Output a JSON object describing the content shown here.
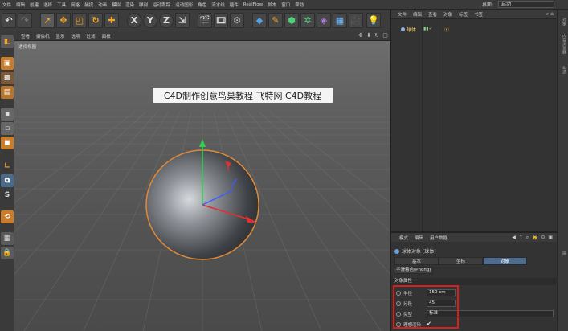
{
  "menubar": {
    "items": [
      "文件",
      "编辑",
      "创建",
      "选择",
      "工具",
      "网格",
      "捕捉",
      "动画",
      "模拟",
      "渲染",
      "雕刻",
      "运动跟踪",
      "运动图形",
      "角色",
      "流水线",
      "插件",
      "RealFlow",
      "脚本",
      "窗口",
      "帮助"
    ],
    "layout_label": "界面:",
    "layout_value": "启动"
  },
  "toolbar": {
    "icons": [
      "undo-icon",
      "redo-icon",
      "live-select-icon",
      "move-icon",
      "scale-icon",
      "rotate-icon",
      "add-icon",
      "x-axis-icon",
      "y-axis-icon",
      "z-axis-icon",
      "world-coord-icon",
      "render-view-icon",
      "render-picture-icon",
      "render-settings-icon",
      "cube-icon",
      "pen-icon",
      "subdivision-icon",
      "cloner-icon",
      "bend-deformer-icon",
      "floor-icon",
      "camera-icon",
      "light-icon"
    ],
    "axis_labels": [
      "X",
      "Y",
      "Z"
    ]
  },
  "viewport": {
    "menu": [
      "查看",
      "摄像机",
      "显示",
      "选项",
      "过滤",
      "面板"
    ],
    "label": "透视视图",
    "watermark": "C4D制作创意鸟巢教程 飞特网 C4D教程"
  },
  "object_manager": {
    "tabs": [
      "文件",
      "编辑",
      "查看",
      "对象",
      "标签",
      "书签"
    ],
    "object_name": "球体"
  },
  "side_strip": {
    "labels": [
      "对象",
      "内容浏览器",
      "构造",
      "层"
    ]
  },
  "attributes": {
    "tabs": [
      "模式",
      "编辑",
      "用户数据"
    ],
    "title": "球体对象 [球体]",
    "subtabs": [
      "基本",
      "坐标",
      "对象"
    ],
    "phong_button": "平滑着色(Phong)",
    "section": "对象属性",
    "rows": [
      {
        "label": "半径",
        "value": "150 cm"
      },
      {
        "label": "分段",
        "value": "45"
      },
      {
        "label": "类型",
        "value": "标准"
      },
      {
        "label": "理想渲染",
        "value": "✔"
      }
    ]
  }
}
